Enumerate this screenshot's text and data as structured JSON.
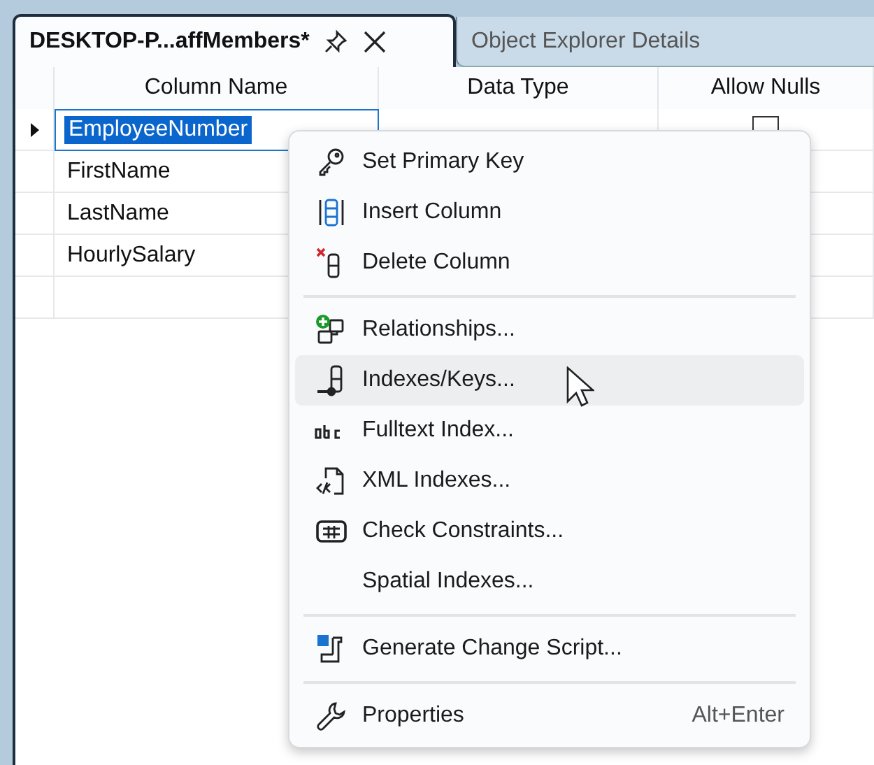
{
  "tabs": [
    {
      "label": "DESKTOP-P...affMembers*",
      "selected": true,
      "pinned": true,
      "closable": true
    },
    {
      "label": "Object Explorer Details",
      "selected": false,
      "pinned": false,
      "closable": false
    }
  ],
  "table": {
    "columns": [
      "Column Name",
      "Data Type",
      "Allow Nulls"
    ],
    "rows": [
      {
        "name": "EmployeeNumber",
        "allow_nulls": false,
        "selected": true
      },
      {
        "name": "FirstName",
        "selected": false
      },
      {
        "name": "LastName",
        "selected": false
      },
      {
        "name": "HourlySalary",
        "selected": false
      },
      {
        "name": "",
        "selected": false
      }
    ]
  },
  "context_menu": {
    "sections": [
      [
        {
          "label": "Set Primary Key",
          "kind": "key",
          "selected": false
        },
        {
          "label": "Insert Column",
          "kind": "insert",
          "selected": false
        },
        {
          "label": "Delete Column",
          "kind": "delete",
          "selected": false
        }
      ],
      [
        {
          "label": "Relationships...",
          "kind": "relations",
          "selected": false
        },
        {
          "label": "Indexes/Keys...",
          "kind": "index",
          "selected": true
        },
        {
          "label": "Fulltext Index...",
          "kind": "fulltext",
          "selected": false
        },
        {
          "label": "XML Indexes...",
          "kind": "xml",
          "selected": false
        },
        {
          "label": "Check Constraints...",
          "kind": "check",
          "selected": false
        },
        {
          "label": "Spatial Indexes...",
          "kind": "plain",
          "selected": false
        }
      ],
      [
        {
          "label": "Generate Change Script...",
          "kind": "script",
          "selected": false
        }
      ],
      [
        {
          "label": "Properties",
          "kind": "properties",
          "shortcut": "Alt+Enter",
          "selected": false
        }
      ]
    ]
  }
}
